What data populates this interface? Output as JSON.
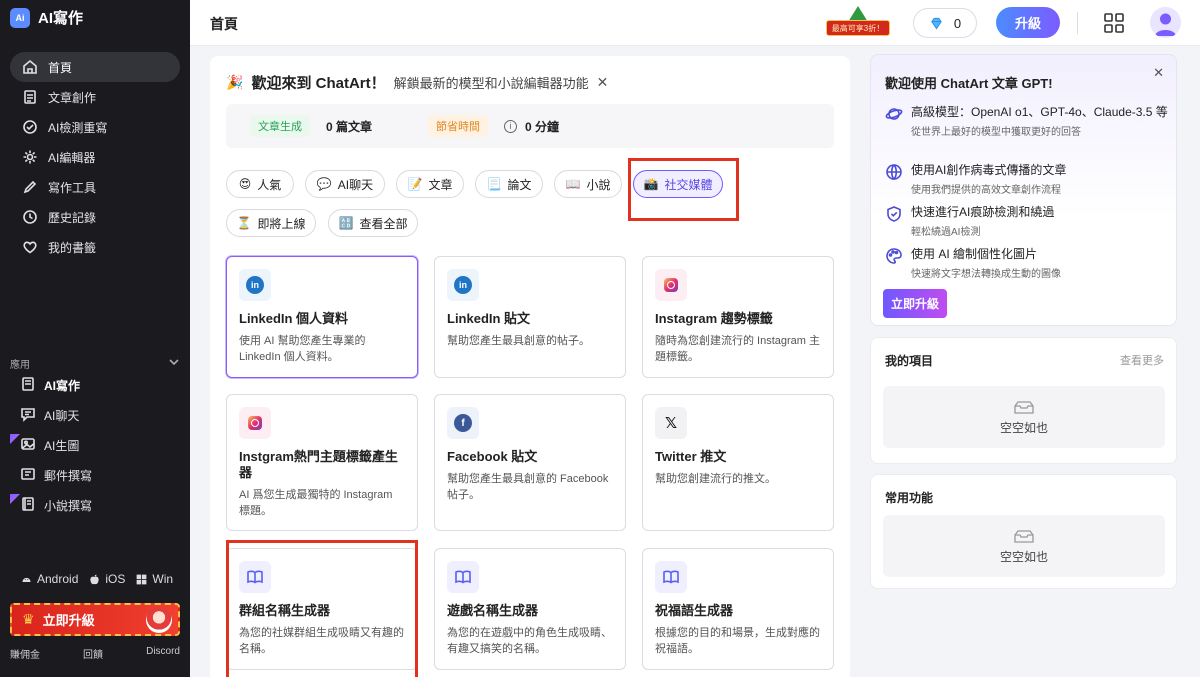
{
  "app": {
    "name": "AI寫作",
    "logo_text": "Ai"
  },
  "sidebar": {
    "nav": [
      {
        "label": "首頁",
        "icon": "home-icon"
      },
      {
        "label": "文章創作",
        "icon": "article-icon"
      },
      {
        "label": "AI檢測重寫",
        "icon": "check-icon"
      },
      {
        "label": "AI編輯器",
        "icon": "gear-icon"
      },
      {
        "label": "寫作工具",
        "icon": "pen-icon"
      },
      {
        "label": "歷史記錄",
        "icon": "history-icon"
      },
      {
        "label": "我的書籤",
        "icon": "heart-icon"
      }
    ],
    "apps_label": "應用",
    "apps": [
      {
        "label": "AI寫作",
        "icon": "doc-icon"
      },
      {
        "label": "AI聊天",
        "icon": "chat-icon"
      },
      {
        "label": "AI生圖",
        "icon": "image-icon"
      },
      {
        "label": "郵件撰寫",
        "icon": "mail-icon"
      },
      {
        "label": "小說撰寫",
        "icon": "book-icon"
      }
    ],
    "platforms": [
      "Android",
      "iOS",
      "Win"
    ],
    "upgrade_label": "立即升級",
    "footer": [
      "賺佣金",
      "回饋",
      "Discord"
    ]
  },
  "topbar": {
    "title": "首頁",
    "promo": "最高可享3折！",
    "gems": "0",
    "upgrade": "升級"
  },
  "welcome": {
    "title": "歡迎來到 ChatArt！",
    "subtitle": "解鎖最新的模型和小說編輯器功能"
  },
  "stats": {
    "articles_label": "文章生成",
    "articles_value": "0 篇文章",
    "time_label": "節省時間",
    "time_value": "0 分鐘"
  },
  "categories": [
    {
      "emoji": "😍",
      "label": "人氣"
    },
    {
      "emoji": "💬",
      "label": "AI聊天"
    },
    {
      "emoji": "📝",
      "label": "文章"
    },
    {
      "emoji": "📃",
      "label": "論文"
    },
    {
      "emoji": "📖",
      "label": "小說"
    },
    {
      "emoji": "📸",
      "label": "社交媒體"
    },
    {
      "emoji": "⏳",
      "label": "即將上線"
    },
    {
      "emoji": "🔠",
      "label": "查看全部"
    }
  ],
  "cards": [
    {
      "logo_text": "in",
      "title": "LinkedIn 個人資料",
      "desc": "使用 AI 幫助您產生專業的 LinkedIn 個人資料。"
    },
    {
      "logo_text": "in",
      "title": "LinkedIn 貼文",
      "desc": "幫助您產生最具創意的帖子。"
    },
    {
      "logo_text": "",
      "title": "Instagram 趨勢標籤",
      "desc": "隨時為您創建流行的 Instagram 主題標籤。"
    },
    {
      "logo_text": "",
      "title": "Instgram熱門主題標籤產生器",
      "desc": "AI 爲您生成最獨特的 Instagram 標題。"
    },
    {
      "logo_text": "f",
      "title": "Facebook 貼文",
      "desc": "幫助您產生最具創意的 Facebook 帖子。"
    },
    {
      "logo_text": "𝕏",
      "title": "Twitter 推文",
      "desc": "幫助您創建流行的推文。"
    },
    {
      "logo_text": "",
      "title": "群組名稱生成器",
      "desc": "為您的社媒群組生成吸睛又有趣的名稱。"
    },
    {
      "logo_text": "",
      "title": "遊戲名稱生成器",
      "desc": "為您的在遊戲中的角色生成吸睛、有趣又搞笑的名稱。"
    },
    {
      "logo_text": "",
      "title": "祝福語生成器",
      "desc": "根據您的目的和場景，生成對應的祝福語。"
    }
  ],
  "gpt_panel": {
    "title": "歡迎使用 ChatArt 文章 GPT!",
    "features": [
      {
        "title": "高級模型：OpenAI o1、GPT-4o、Claude-3.5 等",
        "desc": "從世界上最好的模型中獲取更好的回答"
      },
      {
        "title": "使用AI創作病毒式傳播的文章",
        "desc": "使用我們提供的高效文章創作流程"
      },
      {
        "title": "快速進行AI痕跡檢測和繞過",
        "desc": "輕松繞過AI檢測"
      },
      {
        "title": "使用 AI 繪制個性化圖片",
        "desc": "快速將文字想法轉換成生動的圖像"
      }
    ],
    "button": "立即升級"
  },
  "projects": {
    "title": "我的項目",
    "more": "查看更多",
    "empty": "空空如也"
  },
  "favorites": {
    "title": "常用功能",
    "empty": "空空如也"
  }
}
